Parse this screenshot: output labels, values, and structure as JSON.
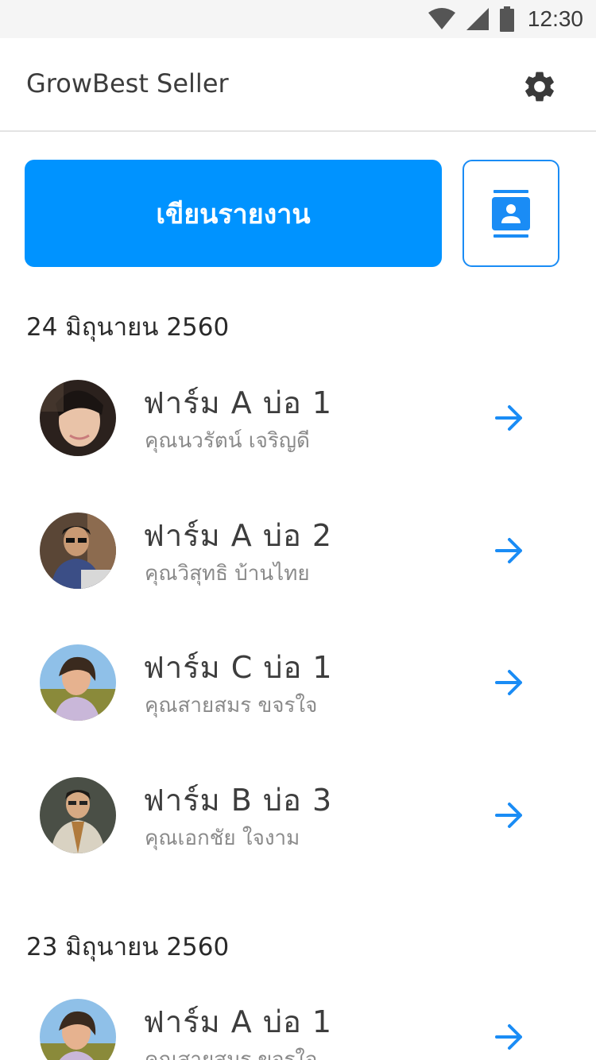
{
  "status_bar": {
    "time": "12:30",
    "icons": [
      "wifi-icon",
      "signal-icon",
      "battery-icon"
    ]
  },
  "app_bar": {
    "title": "GrowBest Seller",
    "settings_icon": "gear-icon"
  },
  "actions": {
    "write_report_label": "เขียนรายงาน",
    "contacts_icon": "contacts-icon"
  },
  "colors": {
    "primary": "#0093ff",
    "arrow": "#1a8cf5",
    "title_text": "#3d3d3d",
    "subtitle_text": "#8a8a8a",
    "status_bar_bg": "#f5f5f5"
  },
  "sections": [
    {
      "date": "24 มิถุนายน 2560",
      "items": [
        {
          "title": "ฟาร์ม A บ่อ 1",
          "subtitle": "คุณนวรัตน์ เจริญดี"
        },
        {
          "title": "ฟาร์ม A บ่อ 2",
          "subtitle": "คุณวิสุทธิ บ้านไทย"
        },
        {
          "title": "ฟาร์ม C บ่อ 1",
          "subtitle": "คุณสายสมร ขจรใจ"
        },
        {
          "title": "ฟาร์ม B บ่อ 3",
          "subtitle": "คุณเอกชัย ใจงาม"
        }
      ]
    },
    {
      "date": "23 มิถุนายน 2560",
      "items": [
        {
          "title": "ฟาร์ม A บ่อ 1",
          "subtitle": "คุณสายสมร ขจรใจ"
        }
      ]
    }
  ]
}
